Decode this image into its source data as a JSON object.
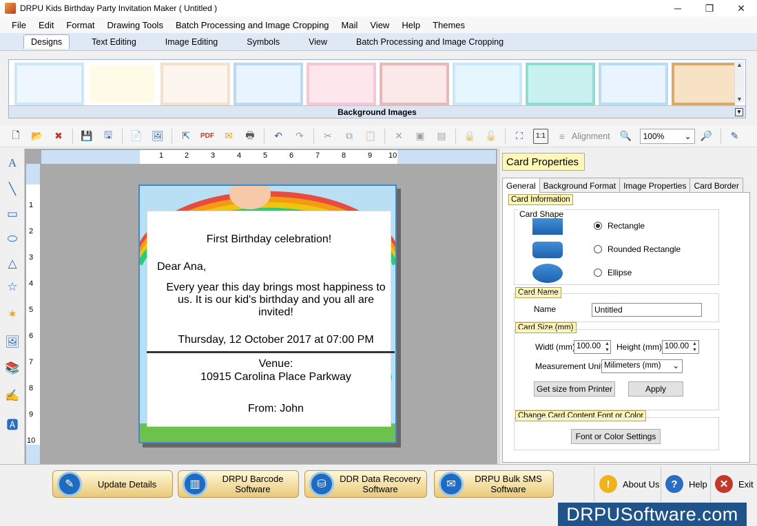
{
  "window": {
    "title": "DRPU Kids Birthday Party Invitation Maker ( Untitled )",
    "minimize": "─",
    "restore": "❐",
    "close": "✕"
  },
  "menu": [
    "File",
    "Edit",
    "Format",
    "Drawing Tools",
    "Batch Processing and Image Cropping",
    "Mail",
    "View",
    "Help",
    "Themes"
  ],
  "ribbon_tabs": [
    "Designs",
    "Text Editing",
    "Image Editing",
    "Symbols",
    "View",
    "Batch Processing and Image Cropping"
  ],
  "gallery": {
    "footer": "Background Images",
    "thumb_colors": [
      "#eef7ff",
      "#fffbe6",
      "#fdf6ef",
      "#e8f4ff",
      "#fde7ec",
      "#fbe9ea",
      "#e6f6ff",
      "#c9f1ef",
      "#eaf4ff",
      "#f7e2c6"
    ]
  },
  "toolbar": {
    "alignment_label": "Alignment",
    "zoom_value": "100%"
  },
  "ruler": {
    "h_ticks": [
      "1",
      "2",
      "3",
      "4",
      "5",
      "6",
      "7",
      "8",
      "9",
      "10"
    ],
    "v_ticks": [
      "1",
      "2",
      "3",
      "4",
      "5",
      "6",
      "7",
      "8",
      "9",
      "10"
    ]
  },
  "card": {
    "heading": "First Birthday celebration!",
    "greeting": "Dear Ana,",
    "body_line1": "Every year this day brings most happiness to",
    "body_line2": "us. It is our kid's birthday and you all are",
    "body_line3": "invited!",
    "date": "Thursday, 12 October 2017 at 07:00 PM",
    "venue_label": "Venue:",
    "venue": "10915 Carolina Place Parkway",
    "from": "From: John"
  },
  "properties": {
    "title": "Card Properties",
    "tabs": [
      "General",
      "Background Format",
      "Image Properties",
      "Card Border"
    ],
    "card_information": "Card Information",
    "card_shape": "Card Shape",
    "shape_options": [
      "Rectangle",
      "Rounded Rectangle",
      "Ellipse"
    ],
    "selected_shape": "Rectangle",
    "card_name_group": "Card Name",
    "name_label": "Name",
    "name_value": "Untitled",
    "card_size_group": "Card Size (mm)",
    "width_label": "Widtl (mm)",
    "width_value": "100.00",
    "height_label": "Height   (mm)",
    "height_value": "100.00",
    "unit_label": "Measurement Unit :",
    "unit_value": "Milimeters (mm)",
    "get_size_button": "Get size from Printer",
    "apply_button": "Apply",
    "font_group": "Change Card Content Font or Color",
    "font_button": "Font or Color Settings"
  },
  "bottom": {
    "update_details": "Update Details",
    "barcode_line1": "DRPU Barcode",
    "barcode_line2": "Software",
    "recovery_line1": "DDR Data Recovery",
    "recovery_line2": "Software",
    "sms_line1": "DRPU Bulk SMS",
    "sms_line2": "Software",
    "about": "About Us",
    "help": "Help",
    "exit": "Exit"
  },
  "brand": "DRPUSoftware.com",
  "colors": {
    "accent_blue": "#1e6bbf",
    "label_yellow": "#fff7b5",
    "brand_bg": "#20538a"
  }
}
